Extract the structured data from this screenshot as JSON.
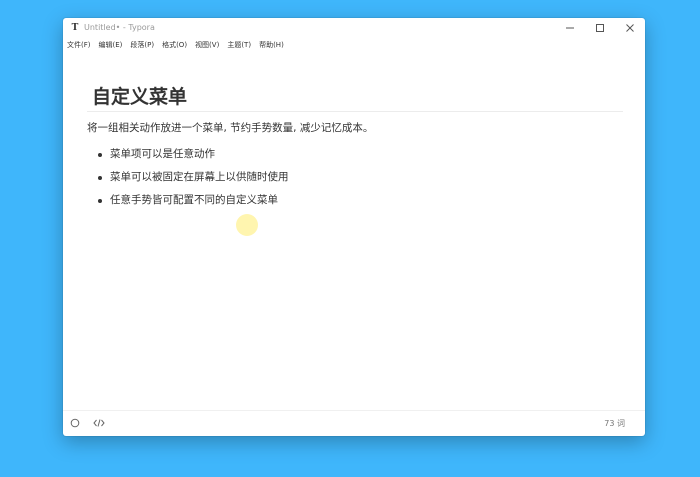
{
  "window": {
    "title": "Untitled• - Typora",
    "app_icon_glyph": "T",
    "controls": [
      "minimize-icon",
      "maximize-icon",
      "close-icon"
    ]
  },
  "menubar": {
    "items": [
      "文件(F)",
      "编辑(E)",
      "段落(P)",
      "格式(O)",
      "视图(V)",
      "主题(T)",
      "帮助(H)"
    ]
  },
  "document": {
    "heading": "自定义菜单",
    "paragraph": "将一组相关动作放进一个菜单, 节约手势数量, 减少记忆成本。",
    "bullets": [
      "菜单项可以是任意动作",
      "菜单可以被固定在屏幕上以供随时使用",
      "任意手势皆可配置不同的自定义菜单"
    ]
  },
  "statusbar": {
    "left_icons": [
      "outline-circle-icon",
      "source-code-icon"
    ],
    "word_count": "73 词"
  },
  "colors": {
    "desktop": "#3fb6fb",
    "window": "#ffffff",
    "text": "#333333",
    "muted_text": "#9a9a9a",
    "cursor_highlight": "#ffec6e"
  }
}
